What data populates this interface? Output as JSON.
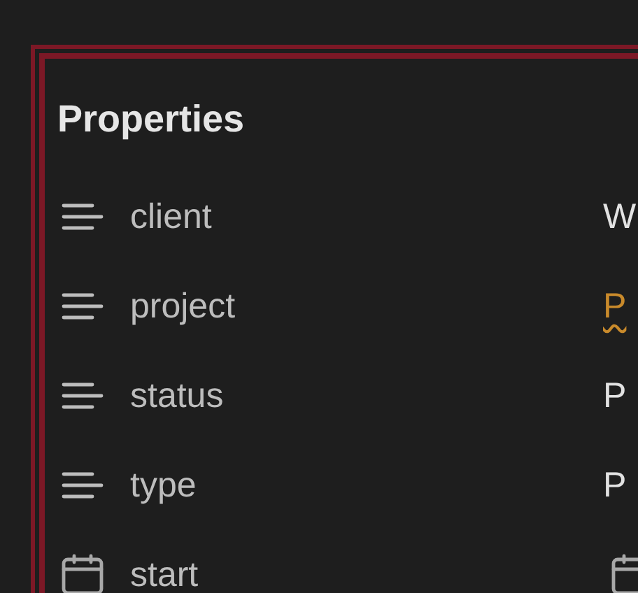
{
  "title": "Properties",
  "properties": [
    {
      "kind": "text",
      "name": "client",
      "value": "W",
      "linked": false,
      "misspelled": false
    },
    {
      "kind": "text",
      "name": "project",
      "value": "P",
      "linked": true,
      "misspelled": true
    },
    {
      "kind": "text",
      "name": "status",
      "value": "P",
      "linked": false,
      "misspelled": false
    },
    {
      "kind": "text",
      "name": "type",
      "value": "P",
      "linked": false,
      "misspelled": false
    },
    {
      "kind": "date",
      "name": "start"
    }
  ]
}
